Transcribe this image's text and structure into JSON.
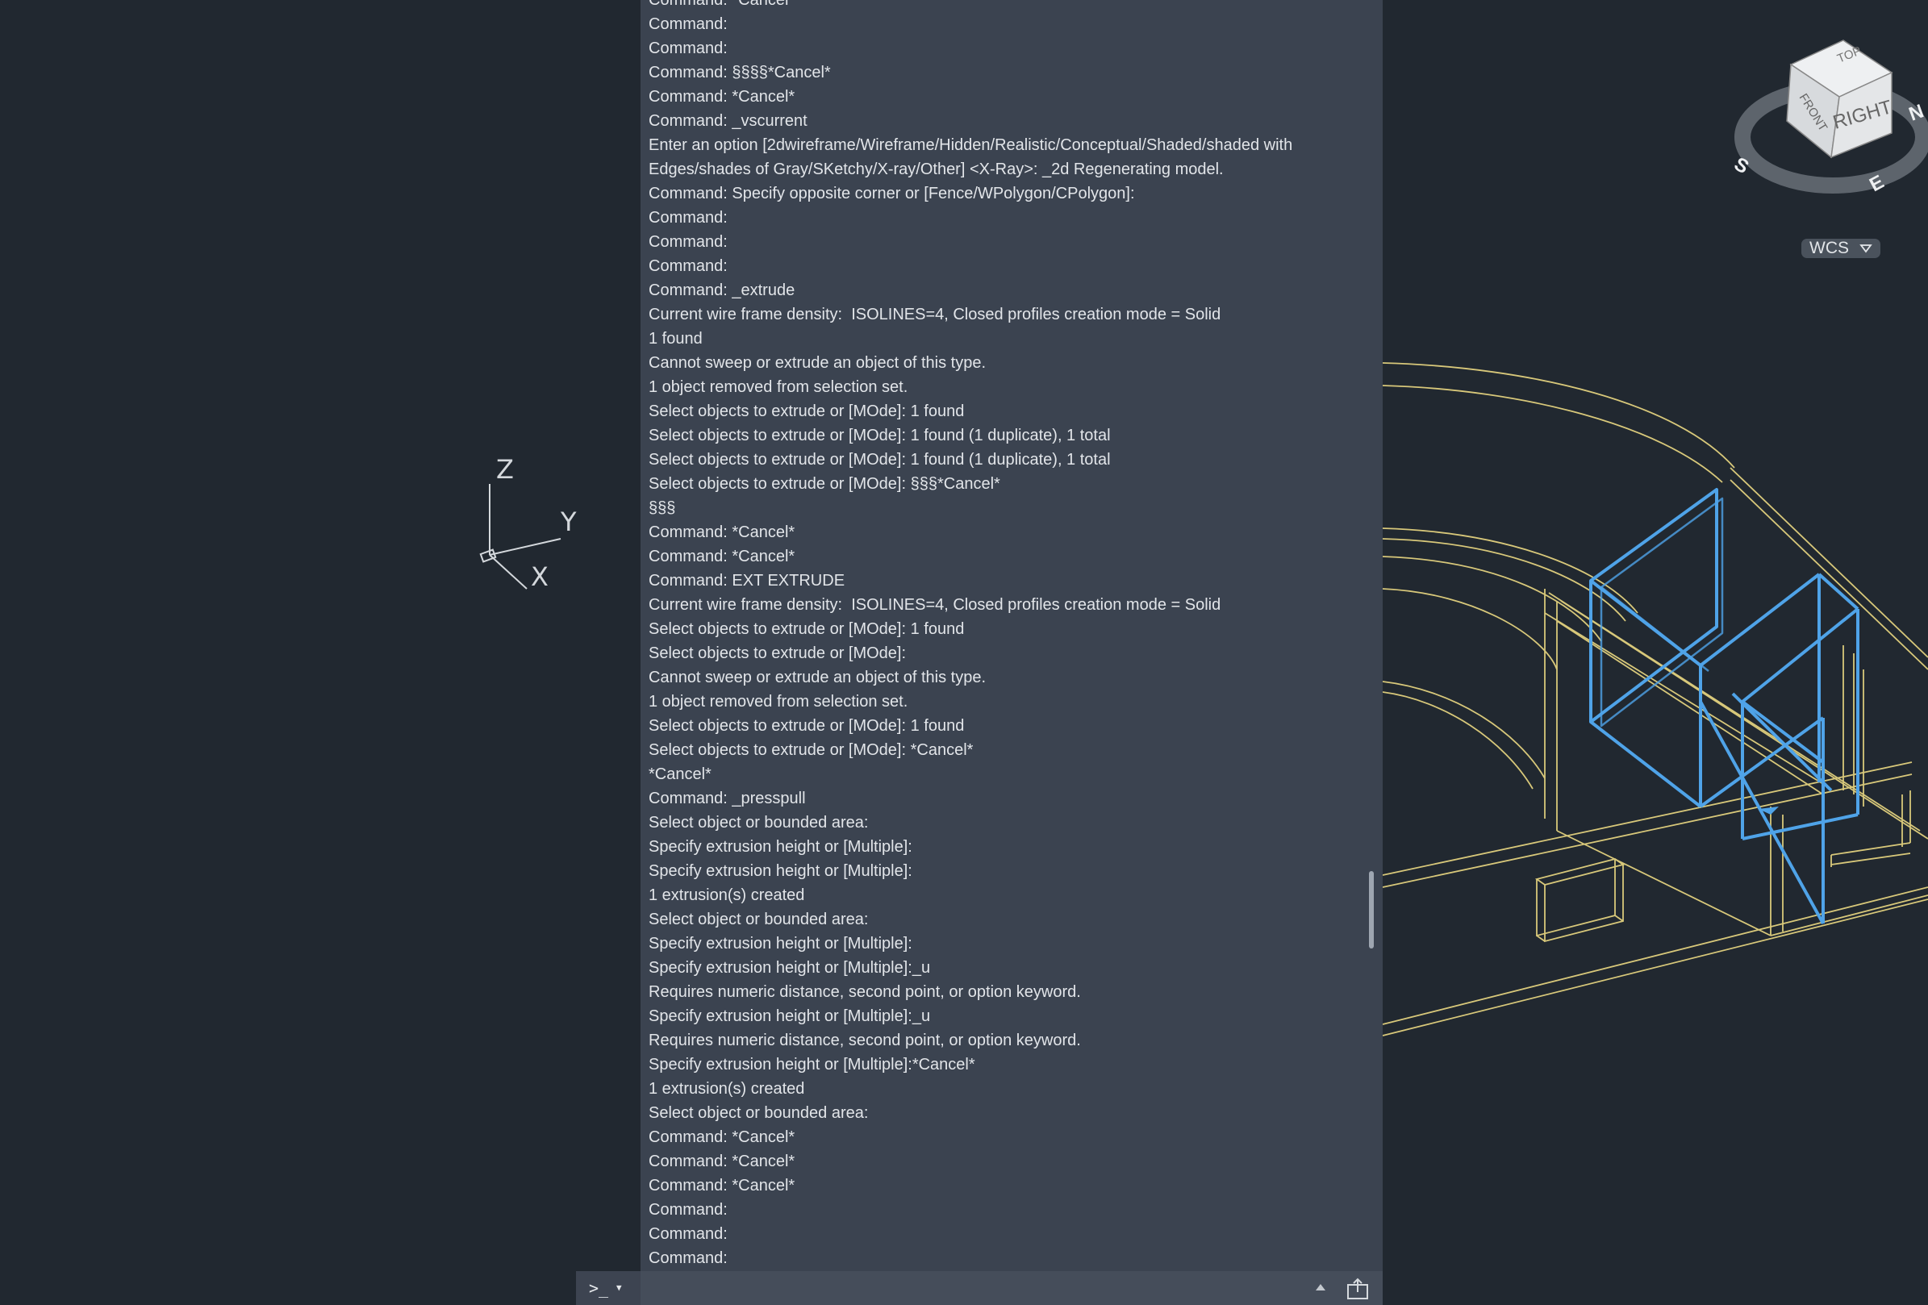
{
  "viewcube": {
    "face_top": "TOP",
    "face_front": "FRONT",
    "face_right": "RIGHT",
    "compass_s": "S",
    "compass_e": "E",
    "compass_n": "N"
  },
  "ucs_labels": {
    "x": "X",
    "y": "Y",
    "z": "Z"
  },
  "wcs_menu": {
    "label": "WCS"
  },
  "command_history": {
    "lines": [
      "Command: *Cancel*",
      "Command:",
      "Command:",
      "Command: §§§§*Cancel*",
      "Command: *Cancel*",
      "Command: _vscurrent",
      "Enter an option [2dwireframe/Wireframe/Hidden/Realistic/Conceptual/Shaded/shaded with",
      "Edges/shades of Gray/SKetchy/X-ray/Other] <X-Ray>: _2d Regenerating model.",
      "Command: Specify opposite corner or [Fence/WPolygon/CPolygon]:",
      "Command:",
      "Command:",
      "Command:",
      "Command: _extrude",
      "Current wire frame density:  ISOLINES=4, Closed profiles creation mode = Solid",
      "1 found",
      "Cannot sweep or extrude an object of this type.",
      "1 object removed from selection set.",
      "Select objects to extrude or [MOde]: 1 found",
      "Select objects to extrude or [MOde]: 1 found (1 duplicate), 1 total",
      "Select objects to extrude or [MOde]: 1 found (1 duplicate), 1 total",
      "Select objects to extrude or [MOde]: §§§*Cancel*",
      "§§§",
      "Command: *Cancel*",
      "Command: *Cancel*",
      "Command: EXT EXTRUDE",
      "Current wire frame density:  ISOLINES=4, Closed profiles creation mode = Solid",
      "Select objects to extrude or [MOde]: 1 found",
      "Select objects to extrude or [MOde]:",
      "Cannot sweep or extrude an object of this type.",
      "1 object removed from selection set.",
      "Select objects to extrude or [MOde]: 1 found",
      "Select objects to extrude or [MOde]: *Cancel*",
      "*Cancel*",
      "Command: _presspull",
      "Select object or bounded area:",
      "Specify extrusion height or [Multiple]:",
      "Specify extrusion height or [Multiple]:",
      "1 extrusion(s) created",
      "Select object or bounded area:",
      "Specify extrusion height or [Multiple]:",
      "Specify extrusion height or [Multiple]:_u",
      "Requires numeric distance, second point, or option keyword.",
      "Specify extrusion height or [Multiple]:_u",
      "Requires numeric distance, second point, or option keyword.",
      "Specify extrusion height or [Multiple]:*Cancel*",
      "1 extrusion(s) created",
      "Select object or bounded area:",
      "Command: *Cancel*",
      "Command: *Cancel*",
      "Command: *Cancel*",
      "Command:",
      "Command:",
      "Command:"
    ]
  },
  "command_line": {
    "prompt_symbol": ">_",
    "prompt_arrow": "▼",
    "input_value": "",
    "input_placeholder": ""
  },
  "colors": {
    "viewport_bg": "#212830",
    "history_bg": "#3b4350",
    "geometry_wire": "#d8c87a",
    "selection_highlight": "#4fa3e8",
    "text": "#e2e5e9"
  }
}
